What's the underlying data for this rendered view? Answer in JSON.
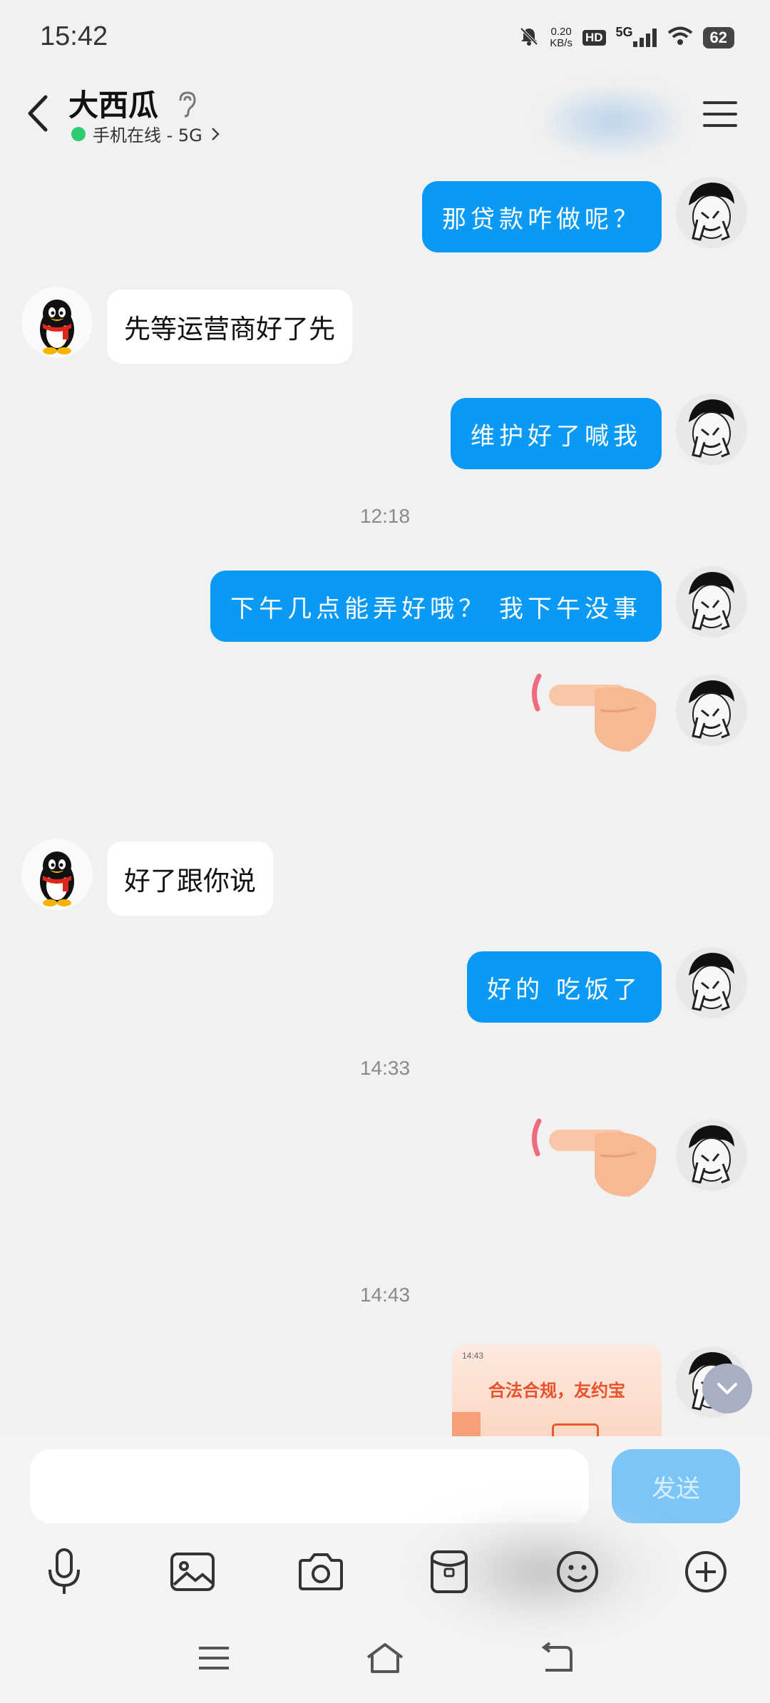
{
  "status_bar": {
    "time": "15:42",
    "net_speed_value": "0.20",
    "net_speed_unit": "KB/s",
    "hd": "HD",
    "signal": "5G",
    "battery": "62"
  },
  "header": {
    "title": "大西瓜",
    "subtitle": "手机在线 - 5G"
  },
  "messages": [
    {
      "side": "out",
      "text": "那贷款咋做呢？"
    },
    {
      "side": "in",
      "text": "先等运营商好了先"
    },
    {
      "side": "out",
      "text": "维护好了喊我"
    },
    {
      "side": "time",
      "text": "12:18"
    },
    {
      "side": "out",
      "text": "下午几点能弄好哦？ 我下午没事"
    },
    {
      "side": "out",
      "type": "sticker",
      "icon": "pointing-hand-sticker"
    },
    {
      "side": "in",
      "text": "好了跟你说"
    },
    {
      "side": "out",
      "text": "好的 吃饭了"
    },
    {
      "side": "time",
      "text": "14:33"
    },
    {
      "side": "out",
      "type": "sticker",
      "icon": "pointing-hand-sticker"
    },
    {
      "side": "time",
      "text": "14:43"
    },
    {
      "side": "out",
      "type": "image",
      "thumb_time": "14:43",
      "thumb_text": "合法合规，友约宝"
    }
  ],
  "input": {
    "placeholder": "",
    "send_label": "发送"
  },
  "toolbar": [
    "microphone-icon",
    "image-icon",
    "camera-icon",
    "red-packet-icon",
    "emoji-icon",
    "plus-icon"
  ],
  "nav": [
    "menu-icon",
    "home-icon",
    "back-icon"
  ],
  "colors": {
    "outgoing_bubble": "#0a99f5",
    "incoming_bubble": "#ffffff",
    "background": "#f1f1f1",
    "send_button": "#7cc6f7",
    "online_dot": "#2ecc71"
  }
}
